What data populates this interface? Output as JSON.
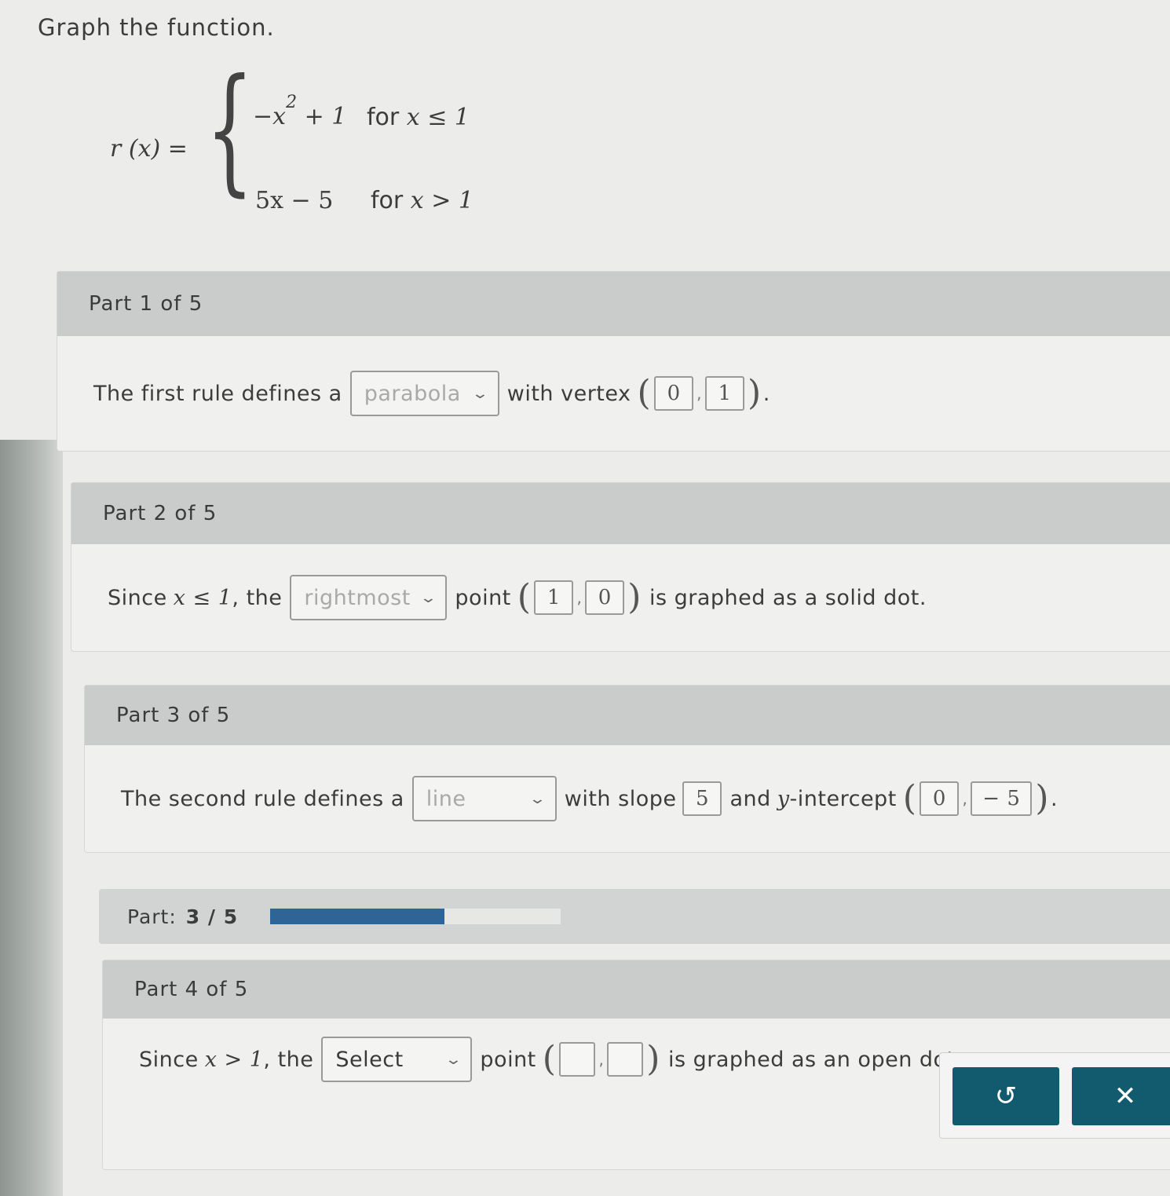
{
  "prompt": "Graph the function.",
  "function": {
    "lhs": "r (x) =",
    "rule1_expr_main": "−x",
    "rule1_expr_exp": "2",
    "rule1_expr_tail": "+ 1",
    "rule1_cond_word": "for",
    "rule1_cond_math": "x ≤ 1",
    "rule2_expr": "5x − 5",
    "rule2_cond_word": "for",
    "rule2_cond_math": "x > 1"
  },
  "part1": {
    "header": "Part 1 of 5",
    "text_before": "The first rule defines a",
    "dropdown_value": "parabola",
    "text_after": "with vertex",
    "vertex_x": "0",
    "vertex_y": "1",
    "end": "."
  },
  "part2": {
    "header": "Part 2 of 5",
    "since": "Since",
    "cond": "x ≤ 1",
    "the": ", the",
    "dropdown_value": "rightmost",
    "point_word": "point",
    "point_x": "1",
    "point_y": "0",
    "tail": "is graphed as a solid dot."
  },
  "part3": {
    "header": "Part 3 of 5",
    "text_before": "The second rule defines a",
    "dropdown_value": "line",
    "slope_text": "with slope",
    "slope": "5",
    "intercept_and": "and",
    "intercept_var": "y",
    "intercept_text": "-intercept",
    "intercept_x": "0",
    "intercept_y": "− 5",
    "end": "."
  },
  "progress": {
    "label": "Part:",
    "value": "3 / 5",
    "fraction": 0.6
  },
  "part4": {
    "header": "Part 4 of 5",
    "since": "Since",
    "cond": "x > 1",
    "the": ", the",
    "dropdown_value": "Select",
    "point_word": "point",
    "tail": "is graphed as an open dot."
  },
  "actions": {
    "undo_icon": "undo-icon",
    "close_icon": "close-icon",
    "undo_glyph": "↺",
    "close_glyph": "✕"
  }
}
